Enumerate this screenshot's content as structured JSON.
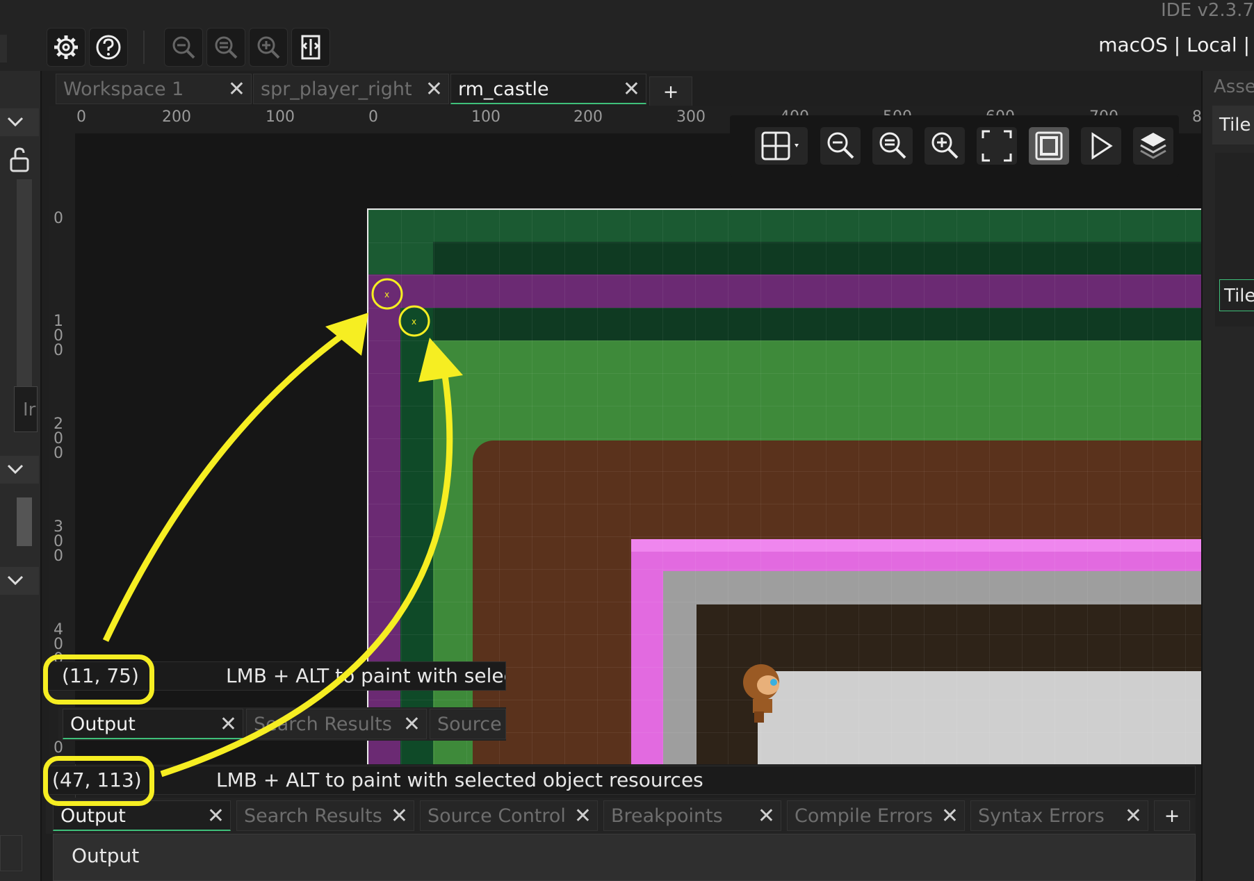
{
  "window": {
    "ide_version": "IDE v2.3.7",
    "target_info": "macOS | Local |"
  },
  "toolbar": {
    "buttons": [
      "gear-icon",
      "help-icon",
      "zoom-out-icon",
      "zoom-reset-icon",
      "zoom-in-icon",
      "device-icon"
    ]
  },
  "tabs": [
    {
      "label": "Workspace 1",
      "close": "✕"
    },
    {
      "label": "spr_player_right",
      "close": "✕"
    },
    {
      "label": "rm_castle",
      "close": "✕"
    },
    {
      "label": "+"
    }
  ],
  "ruler": {
    "top_labels": [
      "0",
      "200",
      "100",
      "0",
      "100",
      "200",
      "300",
      "400",
      "500",
      "600",
      "700",
      "8"
    ],
    "left_labels": [
      "0",
      "100",
      "200",
      "300",
      "400",
      "0"
    ]
  },
  "left_panel": {
    "field_text": "Ir"
  },
  "right_panel": {
    "header": "Asse",
    "item1": "Tile",
    "item2": "Tile"
  },
  "room_toolbar": {
    "buttons": [
      "grid-icon",
      "zoom-out-icon",
      "zoom-reset-icon",
      "zoom-in-icon",
      "fit-icon",
      "fullscreen-icon",
      "play-icon",
      "layers-icon"
    ]
  },
  "overlay_status": {
    "coords": "(11, 75)",
    "message": "LMB + ALT to paint with selecte"
  },
  "overlay_tabs": [
    {
      "label": "Output",
      "close": "✕"
    },
    {
      "label": "Search Results",
      "close": "✕"
    },
    {
      "label": "Source ("
    }
  ],
  "status": {
    "coords": "(47, 113)",
    "message": "LMB + ALT to paint with selected object resources"
  },
  "bottom_tabs": [
    {
      "label": "Output",
      "close": "✕"
    },
    {
      "label": "Search Results",
      "close": "✕"
    },
    {
      "label": "Source Control",
      "close": "✕"
    },
    {
      "label": "Breakpoints",
      "close": "✕"
    },
    {
      "label": "Compile Errors",
      "close": "✕"
    },
    {
      "label": "Syntax Errors",
      "close": "✕"
    },
    {
      "label": "+"
    }
  ],
  "output_panel": {
    "text": "Output"
  },
  "colors": {
    "annotation": "#f6ee22",
    "active_tab_line": "#3fc07a",
    "grass_dark": "#123f26",
    "grass_light": "#3e8a3a",
    "purple": "#6b2a73",
    "dirt": "#5a321c",
    "pink": "#e26ae0"
  }
}
